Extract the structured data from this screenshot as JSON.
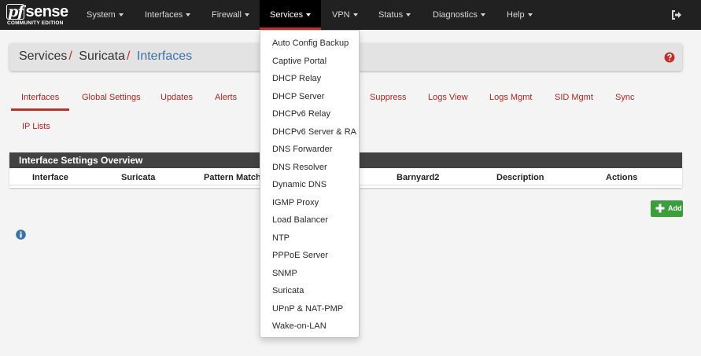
{
  "brand": {
    "logo_pf": "pf",
    "logo_sense": "sense",
    "logo_sub": "COMMUNITY EDITION"
  },
  "nav": {
    "items": [
      {
        "label": "System"
      },
      {
        "label": "Interfaces"
      },
      {
        "label": "Firewall"
      },
      {
        "label": "Services"
      },
      {
        "label": "VPN"
      },
      {
        "label": "Status"
      },
      {
        "label": "Diagnostics"
      },
      {
        "label": "Help"
      }
    ],
    "active": "Services"
  },
  "breadcrumb": {
    "root": "Services",
    "sep": "/",
    "middle": "Suricata",
    "current": "Interfaces"
  },
  "tabs": [
    {
      "label": "Interfaces"
    },
    {
      "label": "Global Settings"
    },
    {
      "label": "Updates"
    },
    {
      "label": "Alerts"
    },
    {
      "label": "Suppress"
    },
    {
      "label": "Logs View"
    },
    {
      "label": "Logs Mgmt"
    },
    {
      "label": "SID Mgmt"
    },
    {
      "label": "Sync"
    },
    {
      "label": "IP Lists"
    }
  ],
  "panel": {
    "title": "Interface Settings Overview",
    "columns": [
      "Interface",
      "Suricata",
      "Pattern Match",
      "Barnyard2",
      "Description",
      "Actions"
    ]
  },
  "add_button": {
    "label": "Add"
  },
  "services_menu": [
    "Auto Config Backup",
    "Captive Portal",
    "DHCP Relay",
    "DHCP Server",
    "DHCPv6 Relay",
    "DHCPv6 Server & RA",
    "DNS Forwarder",
    "DNS Resolver",
    "Dynamic DNS",
    "IGMP Proxy",
    "Load Balancer",
    "NTP",
    "PPPoE Server",
    "SNMP",
    "Suricata",
    "UPnP & NAT-PMP",
    "Wake-on-LAN"
  ],
  "colors": {
    "navbar": "#212121",
    "accent_red": "#c0302a",
    "link_red": "#b4231f",
    "breadcrumb_blue": "#3a72a8",
    "add_green": "#3c9d3c"
  }
}
